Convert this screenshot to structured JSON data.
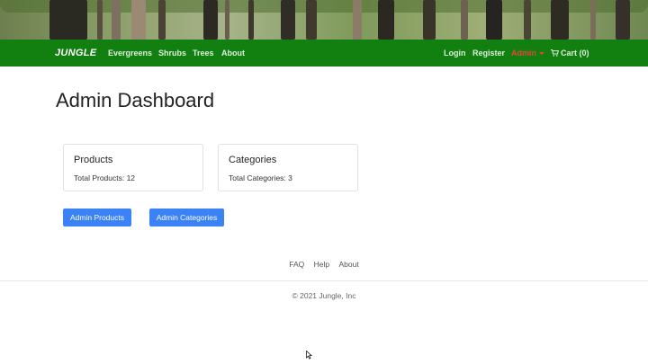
{
  "navbar": {
    "brand": "JUNGLE",
    "links": [
      "Evergreens",
      "Shrubs",
      "Trees",
      "About"
    ],
    "login": "Login",
    "register": "Register",
    "admin": "Admin",
    "cart": "Cart (0)"
  },
  "page": {
    "title": "Admin Dashboard"
  },
  "cards": [
    {
      "title": "Products",
      "text": "Total Products: 12"
    },
    {
      "title": "Categories",
      "text": "Total Categories: 3"
    }
  ],
  "buttons": {
    "products": "Admin Products",
    "categories": "Admin Categories"
  },
  "footer": {
    "links": [
      "FAQ",
      "Help",
      "About"
    ],
    "copyright": "© 2021 Jungle, Inc"
  },
  "colors": {
    "navbar": "#118011",
    "button": "#3b82f6",
    "admin_link": "#e0473a"
  }
}
